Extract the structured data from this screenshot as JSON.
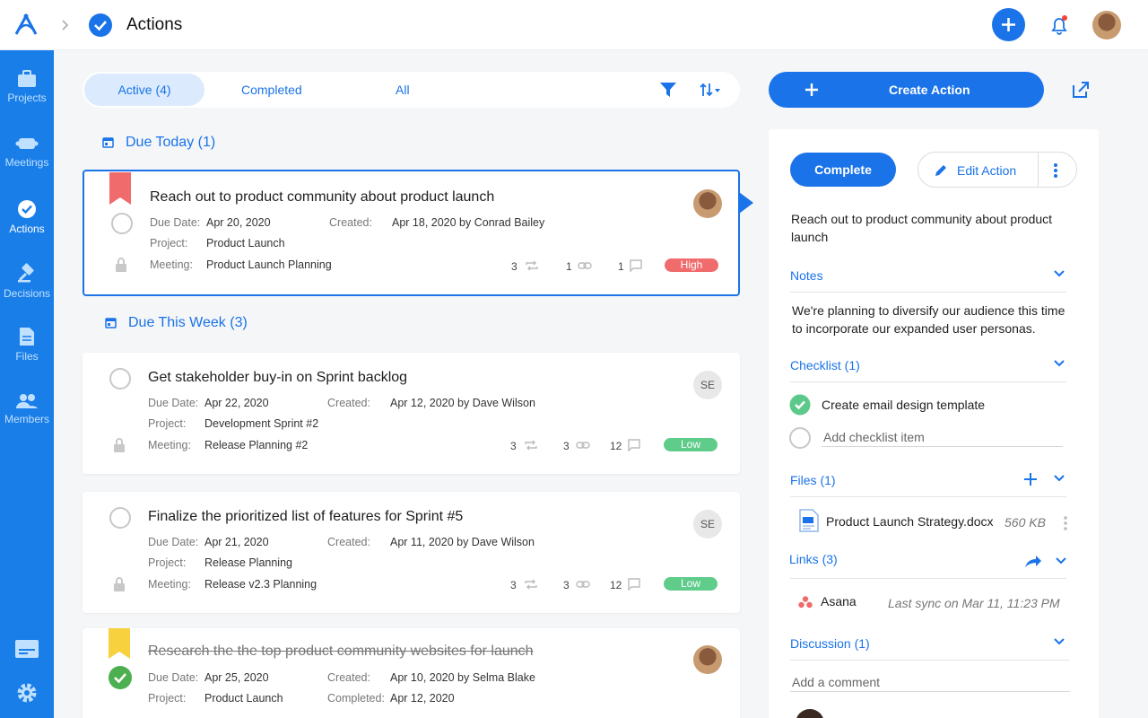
{
  "header": {
    "breadcrumb_title": "Actions"
  },
  "sidebar": {
    "items": [
      {
        "label": "Projects",
        "icon": "briefcase-icon"
      },
      {
        "label": "Meetings",
        "icon": "meetings-icon"
      },
      {
        "label": "Actions",
        "icon": "check-circle-icon"
      },
      {
        "label": "Decisions",
        "icon": "gavel-icon"
      },
      {
        "label": "Files",
        "icon": "file-icon"
      },
      {
        "label": "Members",
        "icon": "members-icon"
      }
    ]
  },
  "filters": {
    "tabs": [
      "Active (4)",
      "Completed",
      "All"
    ]
  },
  "groups": [
    {
      "label": "Due Today (1)"
    },
    {
      "label": "Due This Week (3)"
    }
  ],
  "labels": {
    "due_date": "Due Date:",
    "created": "Created:",
    "project": "Project:",
    "meeting": "Meeting:",
    "completed": "Completed:"
  },
  "cards": [
    {
      "title": "Reach out to product community about product launch",
      "due": "Apr 20, 2020",
      "created": "Apr 18, 2020 by Conrad Bailey",
      "project": "Product Launch",
      "meeting": "Product Launch Planning",
      "recurrence_count": "3",
      "link_count": "1",
      "comment_count": "1",
      "priority": "High",
      "priority_color": "#f06b6b",
      "bookmark_color": "#f06b6b"
    },
    {
      "title": "Get stakeholder buy-in on Sprint backlog",
      "due": "Apr 22, 2020",
      "created": "Apr 12, 2020 by Dave Wilson",
      "project": "Development Sprint #2",
      "meeting": "Release Planning #2",
      "recurrence_count": "3",
      "link_count": "3",
      "comment_count": "12",
      "priority": "Low",
      "priority_color": "#5fcc8a",
      "assignee_initials": "SE"
    },
    {
      "title": "Finalize the prioritized list of features for Sprint #5",
      "due": "Apr 21, 2020",
      "created": "Apr 11, 2020 by Dave Wilson",
      "project": "Release Planning",
      "meeting": "Release v2.3 Planning",
      "recurrence_count": "3",
      "link_count": "3",
      "comment_count": "12",
      "priority": "Low",
      "priority_color": "#5fcc8a",
      "assignee_initials": "SE"
    },
    {
      "title": "Research the the top product community websites for launch",
      "due": "Apr 25, 2020",
      "created": "Apr 10, 2020 by Selma Blake",
      "project": "Product Launch",
      "completed": "Apr 12, 2020",
      "bookmark_color": "#f7d23e"
    }
  ],
  "toolbar": {
    "create_label": "Create Action"
  },
  "detail": {
    "complete_label": "Complete",
    "edit_label": "Edit Action",
    "title": "Reach out to product community about product launch",
    "notes_heading": "Notes",
    "notes_text": "We're planning to diversify our audience this time to incorporate our expanded user personas.",
    "checklist_heading": "Checklist (1)",
    "checklist_item": "Create email design template",
    "checklist_placeholder": "Add checklist item",
    "files_heading": "Files (1)",
    "file_name": "Product Launch Strategy.docx",
    "file_size": "560 KB",
    "links_heading": "Links (3)",
    "link_name": "Asana",
    "link_sync": "Last sync on Mar 11, 11:23 PM",
    "discussion_heading": "Discussion (1)",
    "comment_placeholder": "Add a comment"
  },
  "colors": {
    "accent": "#1a73e8",
    "sidebar": "#1a7ee8",
    "done": "#4caf50"
  }
}
